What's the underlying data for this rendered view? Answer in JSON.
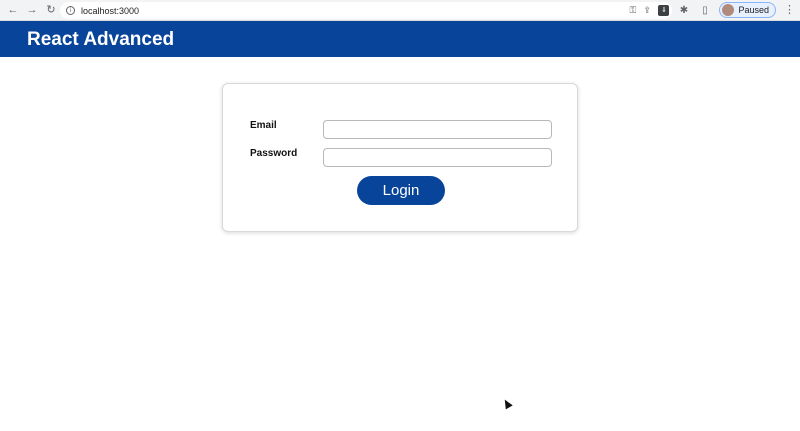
{
  "browser": {
    "url": "localhost:3000",
    "profile_status": "Paused",
    "icons": {
      "back": "←",
      "forward": "→",
      "reload": "↻",
      "info": "i",
      "key": "⚿",
      "share": "⇪",
      "star": "☆",
      "extension": "⇓",
      "puzzle": "✱",
      "sidebar": "▯",
      "menu": "⋮"
    }
  },
  "app": {
    "title": "React Advanced",
    "brand_color": "#08449a"
  },
  "login_form": {
    "email_label": "Email",
    "email_value": "",
    "password_label": "Password",
    "password_value": "",
    "submit_label": "Login"
  }
}
